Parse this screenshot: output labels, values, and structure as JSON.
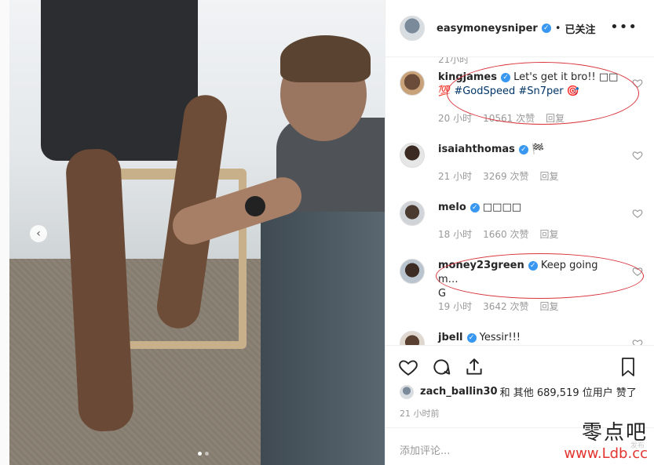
{
  "post": {
    "author": "easymoneysniper",
    "follow_label": "已关注",
    "more_icon": "more-horizontal-icon"
  },
  "comments": {
    "partial_time": "21小时",
    "items": [
      {
        "user": "kingjames",
        "text_before": "Let's get it bro!! □□",
        "text_line2": "💯",
        "tags": "#GodSpeed #Sn7per",
        "text_after": " 🎯",
        "time": "20 小时",
        "likes": "10561 次赞",
        "reply": "回复"
      },
      {
        "user": "isaiahthomas",
        "text_before": "🏁",
        "time": "21 小时",
        "likes": "3269 次赞",
        "reply": "回复"
      },
      {
        "user": "melo",
        "text_before": "□□□□",
        "time": "18 小时",
        "likes": "1660 次赞",
        "reply": "回复"
      },
      {
        "user": "money23green",
        "text_before": "Keep going m…",
        "text_line2": "G",
        "time": "19 小时",
        "likes": "3642 次赞",
        "reply": "回复"
      },
      {
        "user": "jbell",
        "text_before": "Yessir!!!"
      }
    ]
  },
  "actions": {
    "like_icon": "heart-icon",
    "comment_icon": "comment-icon",
    "share_icon": "share-icon",
    "save_icon": "bookmark-icon"
  },
  "likes": {
    "user": "zach_ballin30",
    "text": "和 其他 689,519 位用户 赞了"
  },
  "posted_time": "21 小时前",
  "add_comment_placeholder": "添加评论...",
  "watermark": {
    "cn": "零点吧",
    "url": "www.Ldb.cc",
    "small": "发布"
  },
  "colors": {
    "verified": "#3897f0",
    "hashtag": "#003569",
    "annotation": "#d9333a",
    "watermark_url": "#e3342f"
  }
}
